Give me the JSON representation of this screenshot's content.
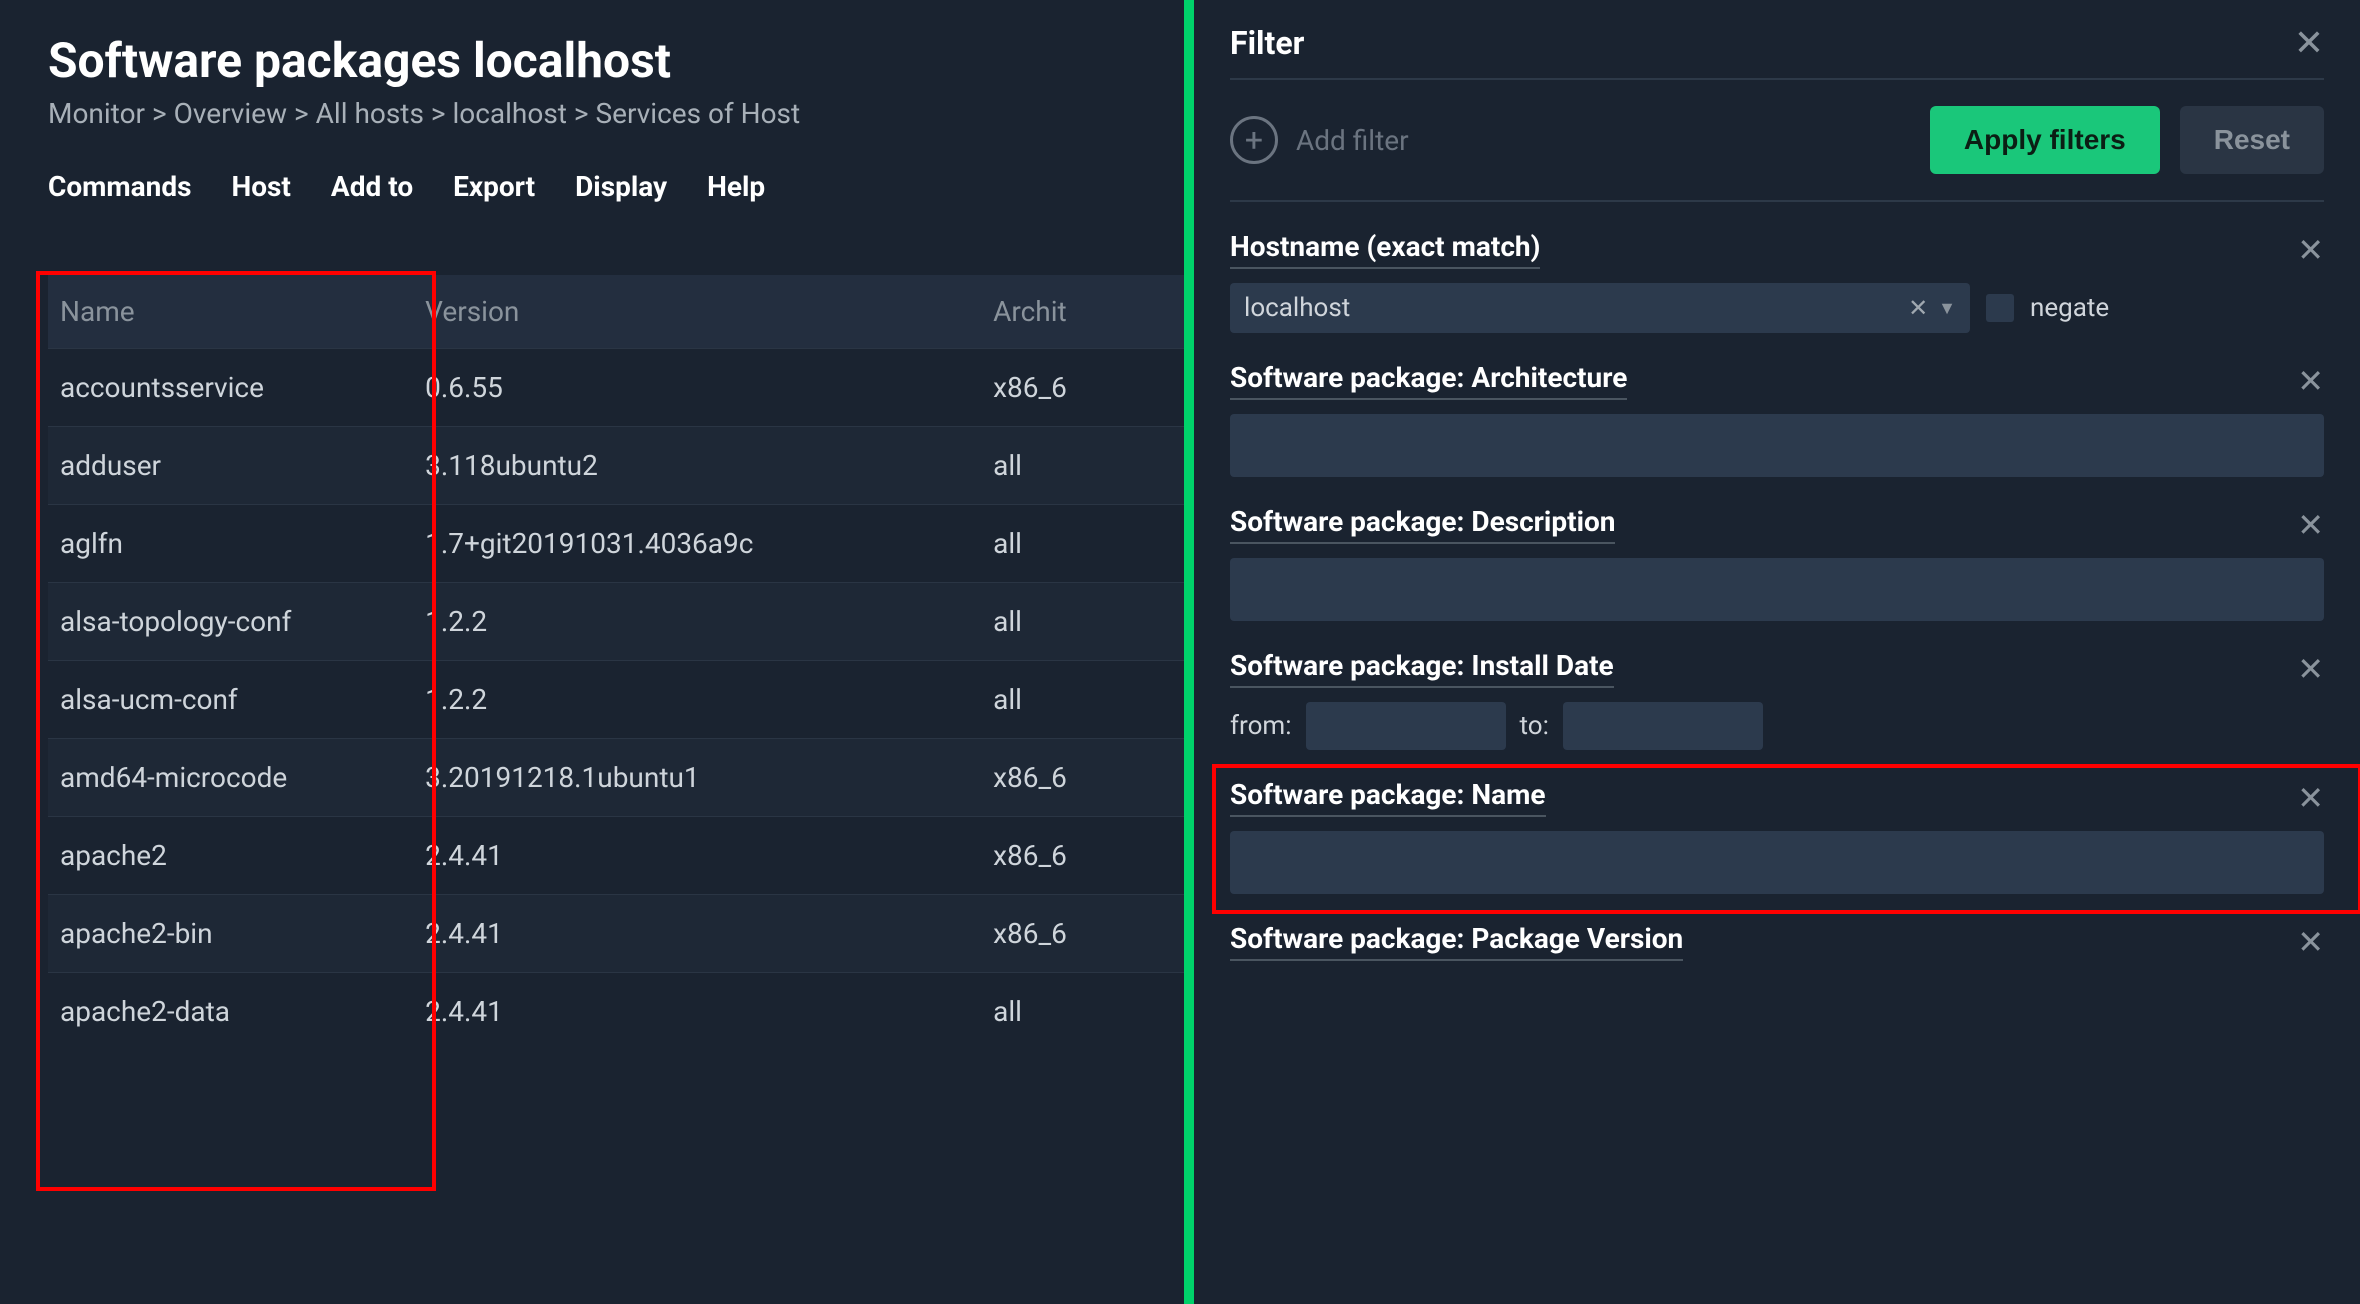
{
  "page": {
    "title": "Software packages localhost",
    "breadcrumb": [
      "Monitor",
      "Overview",
      "All hosts",
      "localhost",
      "Services of Host"
    ]
  },
  "menubar": [
    "Commands",
    "Host",
    "Add to",
    "Export",
    "Display",
    "Help"
  ],
  "table": {
    "columns": [
      "Name",
      "Version",
      "Archit"
    ],
    "rows": [
      {
        "name": "accountsservice",
        "version": "0.6.55",
        "arch": "x86_6"
      },
      {
        "name": "adduser",
        "version": "3.118ubuntu2",
        "arch": "all"
      },
      {
        "name": "aglfn",
        "version": "1.7+git20191031.4036a9c",
        "arch": "all"
      },
      {
        "name": "alsa-topology-conf",
        "version": "1.2.2",
        "arch": "all"
      },
      {
        "name": "alsa-ucm-conf",
        "version": "1.2.2",
        "arch": "all"
      },
      {
        "name": "amd64-microcode",
        "version": "3.20191218.1ubuntu1",
        "arch": "x86_6"
      },
      {
        "name": "apache2",
        "version": "2.4.41",
        "arch": "x86_6"
      },
      {
        "name": "apache2-bin",
        "version": "2.4.41",
        "arch": "x86_6"
      },
      {
        "name": "apache2-data",
        "version": "2.4.41",
        "arch": "all"
      }
    ]
  },
  "filter": {
    "heading": "Filter",
    "add_filter": "Add filter",
    "apply": "Apply filters",
    "reset": "Reset",
    "hostname": {
      "label": "Hostname (exact match)",
      "value": "localhost",
      "negate": "negate"
    },
    "arch": {
      "label": "Software package: Architecture",
      "value": ""
    },
    "desc": {
      "label": "Software package: Description",
      "value": ""
    },
    "install_date": {
      "label": "Software package: Install Date",
      "from_label": "from:",
      "to_label": "to:"
    },
    "name": {
      "label": "Software package: Name",
      "value": ""
    },
    "pkg_version": {
      "label": "Software package: Package Version"
    }
  }
}
